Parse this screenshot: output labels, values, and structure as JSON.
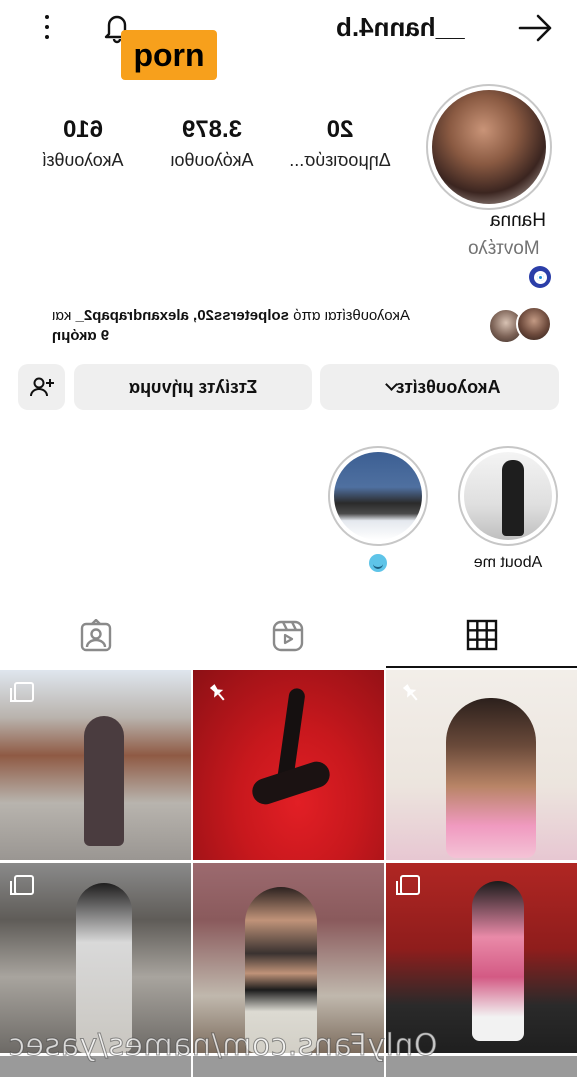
{
  "header": {
    "username": "__hann4.b",
    "badge_text": "porn",
    "icons": [
      "more-vertical-icon",
      "bell-icon",
      "arrow-right-icon"
    ]
  },
  "profile": {
    "stats": [
      {
        "number": "20",
        "label": "Δημοσιεύσ..."
      },
      {
        "number": "3.879",
        "label": "Ακόλουθοι"
      },
      {
        "number": "610",
        "label": "Ακολουθεί"
      }
    ],
    "name": "Hanna",
    "category": "Μοντέλο",
    "followed_by_prefix": "Ακολουθείται από ",
    "followed_by_names": "solpeterss20, alexandrapap2_",
    "followed_by_suffix": " και",
    "followed_by_more": "9 ακόμη"
  },
  "buttons": {
    "follow": "Ακολουθείτε",
    "message": "Στείλτε μήνυμα",
    "add_user_icon": "person-add-icon"
  },
  "highlights": [
    {
      "label": "About me"
    },
    {
      "label": ""
    }
  ],
  "tabs": [
    "grid-icon",
    "reels-icon",
    "tagged-icon"
  ],
  "watermark": "OnlyFans.com/names/yasec",
  "colors": {
    "badge_bg": "#f7a01c",
    "button_bg": "#efefef",
    "secondary_text": "#737373"
  }
}
